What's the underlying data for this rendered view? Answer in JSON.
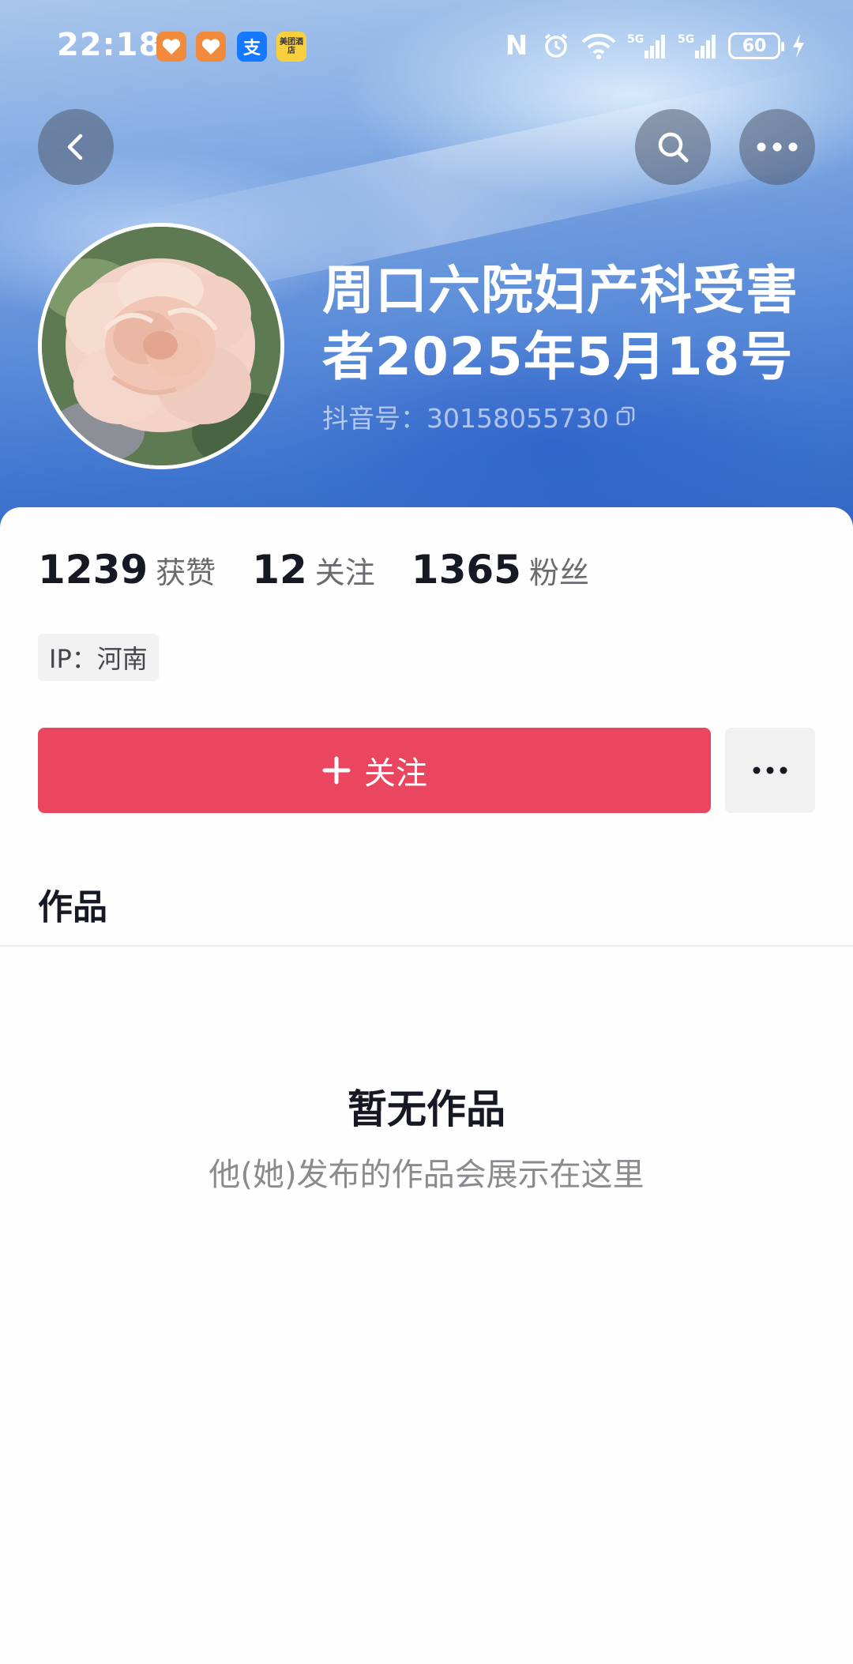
{
  "status_bar": {
    "time": "22:18",
    "app_icons": [
      "douyin-heart-icon",
      "douyin-heart-icon",
      "alipay-icon",
      "meituan-hotel-icon"
    ],
    "alipay_glyph": "支",
    "meituan_text": "美团酒店",
    "network_labels": [
      "5G",
      "5G"
    ],
    "battery": "60"
  },
  "nav": {
    "back_icon": "back-arrow-icon",
    "search_icon": "search-icon",
    "more_icon": "more-dots-icon"
  },
  "profile": {
    "name": "周口六院妇产科受害者2025年5月18号",
    "douyin_id": "抖音号：30158055730"
  },
  "stats": [
    {
      "value": "1239",
      "label": "获赞"
    },
    {
      "value": "12",
      "label": "关注"
    },
    {
      "value": "1365",
      "label": "粉丝"
    }
  ],
  "ip_location": "IP：河南",
  "actions": {
    "follow_label": "关注",
    "follow_color": "#ea4660"
  },
  "tabs": {
    "works": "作品"
  },
  "empty_state": {
    "title": "暂无作品",
    "description": "他(她)发布的作品会展示在这里"
  }
}
